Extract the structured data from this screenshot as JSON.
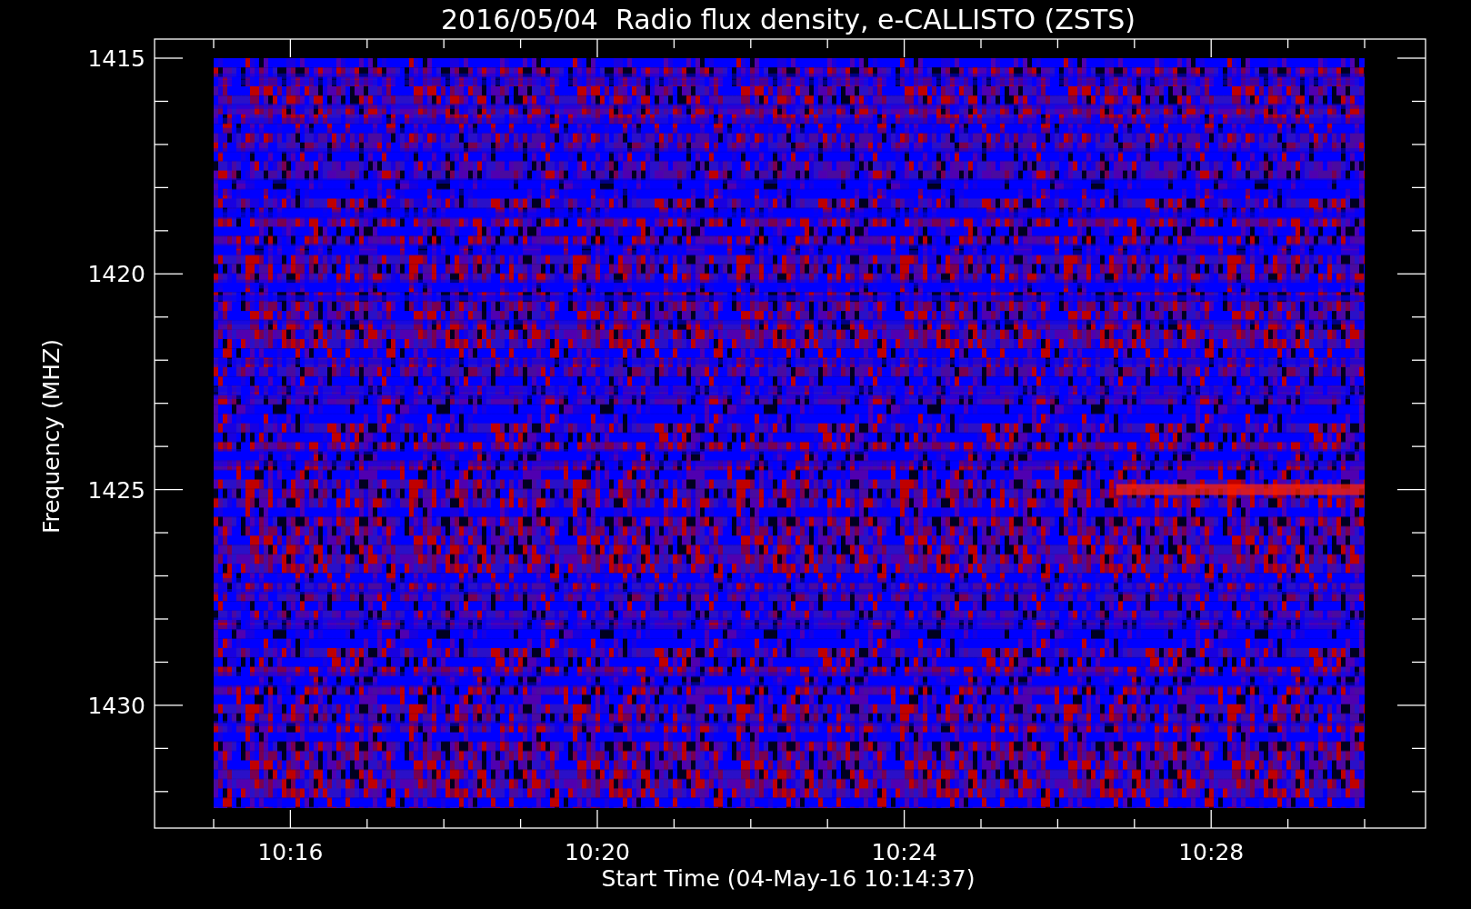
{
  "title": "2016/05/04  Radio flux density, e-CALLISTO (ZSTS)",
  "y_axis": {
    "label": "Frequency (MHZ)",
    "tick_labels": [
      "1415",
      "1420",
      "1425",
      "1430"
    ]
  },
  "x_axis": {
    "label": "Start Time (04-May-16 10:14:37)",
    "tick_labels": [
      "10:16",
      "10:20",
      "10:24",
      "10:28"
    ]
  }
}
